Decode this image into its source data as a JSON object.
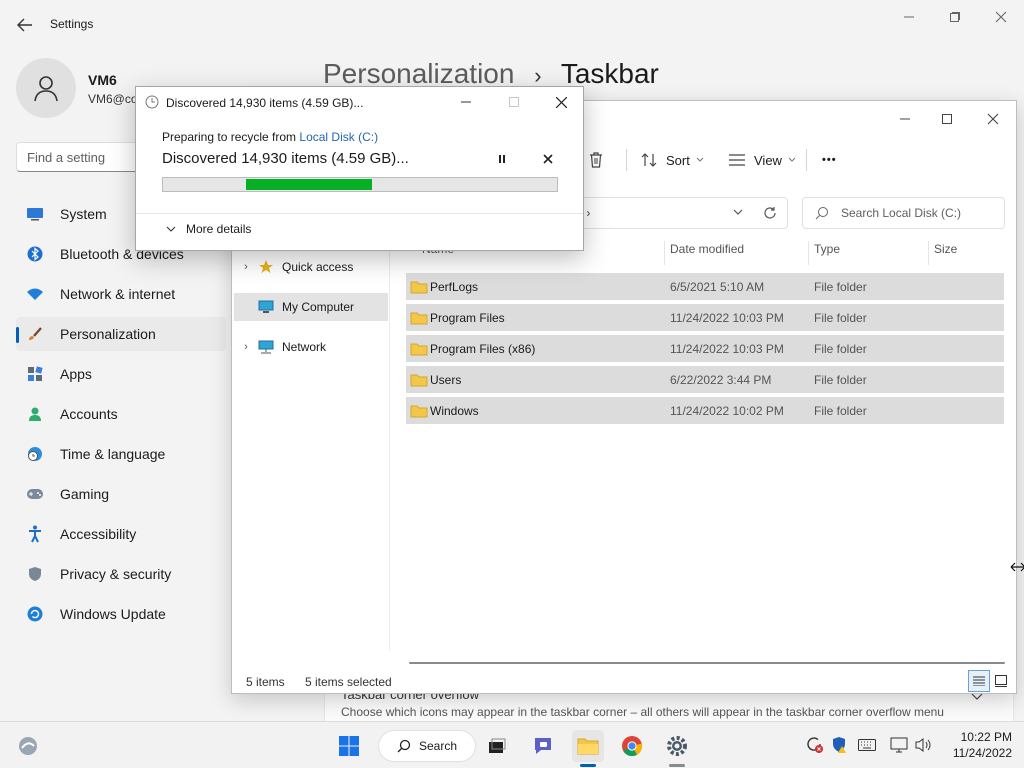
{
  "settings": {
    "title": "Settings",
    "user_name": "VM6",
    "user_email": "VM6@co",
    "search_placeholder": "Find a setting",
    "breadcrumb_parent": "Personalization",
    "breadcrumb_sep": "›",
    "breadcrumb_current": "Taskbar",
    "nav": [
      {
        "label": "System",
        "icon": "monitor-icon"
      },
      {
        "label": "Bluetooth & devices",
        "icon": "bluetooth-icon"
      },
      {
        "label": "Network & internet",
        "icon": "wifi-icon"
      },
      {
        "label": "Personalization",
        "icon": "brush-icon"
      },
      {
        "label": "Apps",
        "icon": "apps-icon"
      },
      {
        "label": "Accounts",
        "icon": "person-icon"
      },
      {
        "label": "Time & language",
        "icon": "globe-clock-icon"
      },
      {
        "label": "Gaming",
        "icon": "gamepad-icon"
      },
      {
        "label": "Accessibility",
        "icon": "accessibility-icon"
      },
      {
        "label": "Privacy & security",
        "icon": "shield-icon"
      },
      {
        "label": "Windows Update",
        "icon": "update-icon"
      }
    ],
    "active_nav": "Personalization",
    "overflow_title": "Taskbar corner overflow",
    "overflow_desc": "Choose which icons may appear in the taskbar corner – all others will appear in the taskbar corner overflow menu"
  },
  "explorer": {
    "toolbar": {
      "sort": "Sort",
      "view": "View",
      "more": "•••"
    },
    "address_tail": ")  ›",
    "search_placeholder": "Search Local Disk (C:)",
    "tree": [
      {
        "label": "Quick access",
        "icon": "star-icon"
      },
      {
        "label": "My Computer",
        "icon": "computer-icon"
      },
      {
        "label": "Network",
        "icon": "network-icon"
      }
    ],
    "columns": {
      "name": "Name",
      "date": "Date modified",
      "type": "Type",
      "size": "Size"
    },
    "rows": [
      {
        "name": "PerfLogs",
        "date": "6/5/2021 5:10 AM",
        "type": "File folder"
      },
      {
        "name": "Program Files",
        "date": "11/24/2022 10:03 PM",
        "type": "File folder"
      },
      {
        "name": "Program Files (x86)",
        "date": "11/24/2022 10:03 PM",
        "type": "File folder"
      },
      {
        "name": "Users",
        "date": "6/22/2022 3:44 PM",
        "type": "File folder"
      },
      {
        "name": "Windows",
        "date": "11/24/2022 10:02 PM",
        "type": "File folder"
      }
    ],
    "status_items": "5 items",
    "status_selected": "5 items selected"
  },
  "dialog": {
    "title": "Discovered 14,930 items (4.59 GB)...",
    "preparing_prefix": "Preparing to recycle from",
    "preparing_link": "Local Disk (C:)",
    "status": "Discovered 14,930 items (4.59 GB)...",
    "progress_marquee_start": 0.21,
    "progress_marquee_end": 0.53,
    "progress_color": "#06b025",
    "more_details": "More details"
  },
  "taskbar": {
    "search_label": "Search",
    "time": "10:22 PM",
    "date": "11/24/2022"
  }
}
